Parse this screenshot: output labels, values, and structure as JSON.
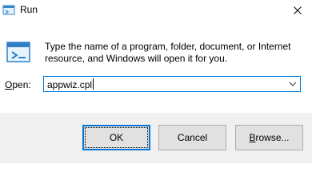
{
  "window": {
    "title": "Run",
    "app_icon": "run-app-icon",
    "close_icon": "close-icon"
  },
  "description": {
    "line1": "Type the name of a program, folder, document, or Internet",
    "line2": "resource, and Windows will open it for you."
  },
  "open_field": {
    "label": "Open:",
    "value": "appwiz.cpl",
    "dropdown_icon": "chevron-down-icon"
  },
  "buttons": {
    "ok": "OK",
    "cancel": "Cancel",
    "browse": "Browse..."
  },
  "colors": {
    "accent": "#0078d7",
    "footer_bg": "#f0f0f0",
    "button_bg": "#e1e1e1"
  }
}
